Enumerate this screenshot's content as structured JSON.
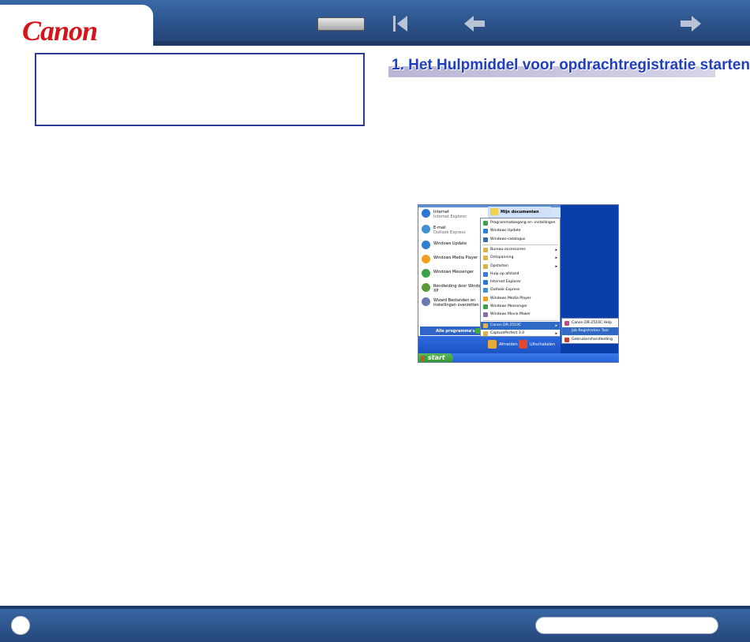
{
  "header": {
    "logo_text": "Canon",
    "nav": {
      "toc_label": "",
      "first_icon": "skip-to-first-icon",
      "prev_icon": "arrow-left-icon",
      "next_icon": "arrow-right-icon"
    }
  },
  "section_title": "1. Het Hulpmiddel voor opdrachtregistratie starten",
  "screenshot": {
    "start_menu_left": [
      {
        "title": "Internet",
        "subtitle": "Internet Explorer",
        "icon": "internet-explorer-icon",
        "color": "#2a77d6"
      },
      {
        "title": "E-mail",
        "subtitle": "Outlook Express",
        "icon": "outlook-express-icon",
        "color": "#3f8fd2"
      },
      {
        "title": "Windows Update",
        "subtitle": "",
        "icon": "windows-update-icon",
        "color": "#2f7fd0"
      },
      {
        "title": "Windows Media Player",
        "subtitle": "",
        "icon": "media-player-icon",
        "color": "#f0a020"
      },
      {
        "title": "Windows Messenger",
        "subtitle": "",
        "icon": "messenger-icon",
        "color": "#3aa04a"
      },
      {
        "title": "Rondleiding door Windows XP",
        "subtitle": "",
        "icon": "tour-icon",
        "color": "#5b9a3a"
      },
      {
        "title": "Wizard Bestanden en instellingen overzetten",
        "subtitle": "",
        "icon": "transfer-wizard-icon",
        "color": "#6a7ab0"
      }
    ],
    "all_programs_label": "Alle programma's",
    "my_documents_label": "Mijn documenten",
    "programs_menu": [
      {
        "label": "Programmatoegang en -instellingen",
        "color": "#3aa04a",
        "arrow": ""
      },
      {
        "label": "Windows Update",
        "color": "#2f7fd0",
        "arrow": ""
      },
      {
        "label": "Windows-catalogus",
        "color": "#3a6ab0",
        "arrow": ""
      },
      {
        "label": "Bureau-accessoires",
        "color": "#d8b44a",
        "arrow": "▸"
      },
      {
        "label": "Ontspanning",
        "color": "#d8b44a",
        "arrow": "▸"
      },
      {
        "label": "Opstarten",
        "color": "#d8b44a",
        "arrow": "▸"
      },
      {
        "label": "Hulp op afstand",
        "color": "#3a7ad8",
        "arrow": ""
      },
      {
        "label": "Internet Explorer",
        "color": "#2a77d6",
        "arrow": ""
      },
      {
        "label": "Outlook Express",
        "color": "#3f8fd2",
        "arrow": ""
      },
      {
        "label": "Windows Media Player",
        "color": "#f0a020",
        "arrow": ""
      },
      {
        "label": "Windows Messenger",
        "color": "#3aa04a",
        "arrow": ""
      },
      {
        "label": "Windows Movie Maker",
        "color": "#8a6ab0",
        "arrow": ""
      },
      {
        "label": "Canon DR-2510C",
        "color": "#d8b44a",
        "arrow": "▸"
      },
      {
        "label": "CapturePerfect 3.0",
        "color": "#d8b44a",
        "arrow": "▸"
      }
    ],
    "submenu": [
      {
        "label": "Canon DR-2510C Help",
        "color": "#c04a8a"
      },
      {
        "label": "Job Registration Tool",
        "color": "#3a6ac8"
      },
      {
        "label": "Gebruikershandleiding",
        "color": "#d03a2a"
      }
    ],
    "log_off_label": "Afmelden",
    "shutdown_label": "Uitschakelen",
    "start_label": "start"
  },
  "colors": {
    "header_blue": "#2a4f86",
    "canon_red": "#d7141a",
    "title_blue": "#1f3fbf",
    "note_border": "#2a3b9c"
  },
  "footer": {
    "page_number": "",
    "pill_text": ""
  }
}
